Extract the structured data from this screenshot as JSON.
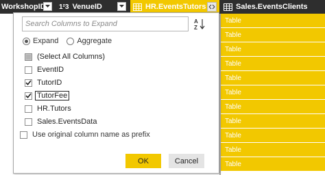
{
  "colors": {
    "header_bg": "#2e2e2e",
    "accent": "#f2c800",
    "cell_text": "#ffffff",
    "popup_border": "#a6a6a6"
  },
  "columns": [
    {
      "label": "WorkshopID",
      "icon": "none"
    },
    {
      "label": "VenueID",
      "type_icon": "1²3",
      "icon": "number-type-icon"
    },
    {
      "label": "HR.EventsTutors",
      "icon": "table-icon",
      "selected": true
    },
    {
      "label": "Sales.EventsClients",
      "icon": "table-icon"
    }
  ],
  "table_cells": [
    "Table",
    "Table",
    "Table",
    "Table",
    "Table",
    "Table",
    "Table",
    "Table",
    "Table",
    "Table",
    "Table"
  ],
  "popup": {
    "search": {
      "placeholder": "Search Columns to Expand",
      "value": ""
    },
    "sort_icon": "sort-az-icon",
    "mode_options": [
      {
        "label": "Expand",
        "selected": true
      },
      {
        "label": "Aggregate",
        "selected": false
      }
    ],
    "column_items": [
      {
        "label": "(Select All Columns)",
        "state": "partial"
      },
      {
        "label": "EventID",
        "state": "unchecked"
      },
      {
        "label": "TutorID",
        "state": "checked"
      },
      {
        "label": "TutorFee",
        "state": "checked",
        "focused": true
      },
      {
        "label": "HR.Tutors",
        "state": "unchecked"
      },
      {
        "label": "Sales.EventsData",
        "state": "unchecked"
      }
    ],
    "prefix_label": "Use original column name as prefix",
    "prefix_checked": false,
    "ok_label": "OK",
    "cancel_label": "Cancel"
  }
}
